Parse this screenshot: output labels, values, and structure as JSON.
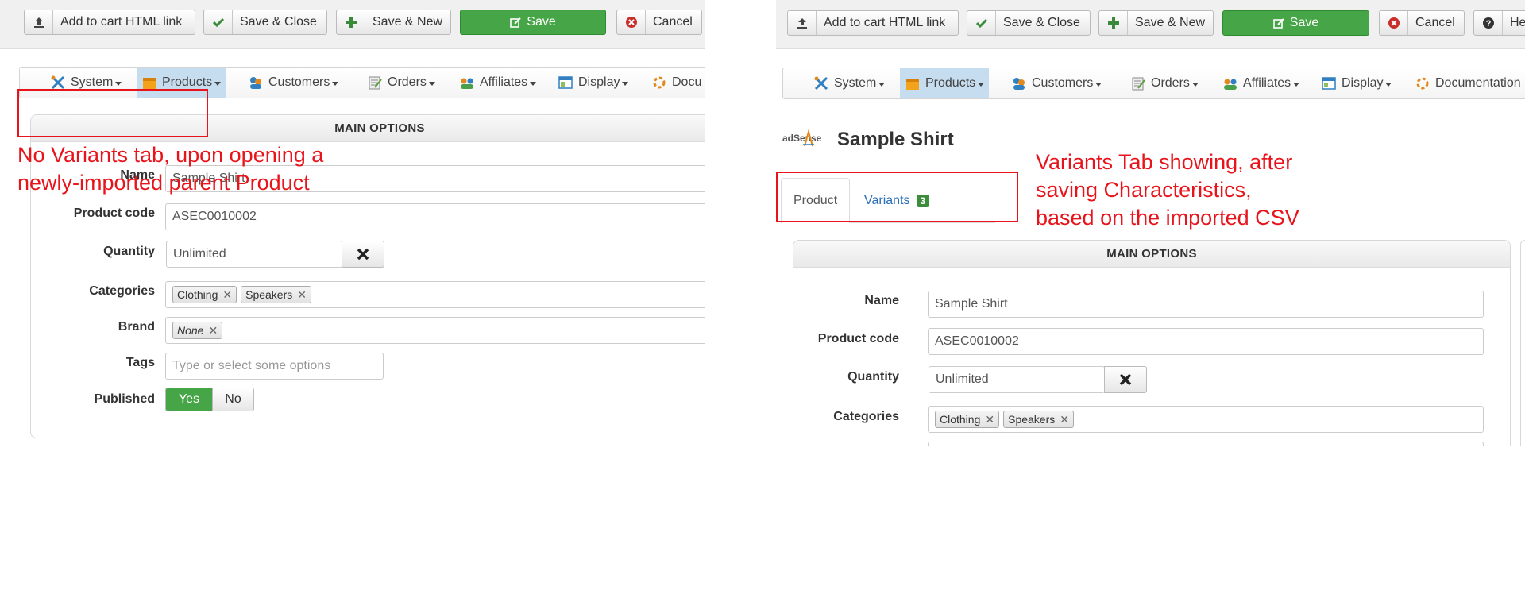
{
  "toolbar": {
    "add_to_cart_label": "Add to cart HTML link",
    "save_close_label": "Save & Close",
    "save_new_label": "Save & New",
    "save_label": "Save",
    "cancel_label": "Cancel",
    "help_label": "He"
  },
  "menu": {
    "system": "System",
    "products": "Products",
    "customers": "Customers",
    "orders": "Orders",
    "affiliates": "Affiliates",
    "display": "Display",
    "documentation_left": "Docu",
    "documentation_right": "Documentation"
  },
  "main_options_title": "MAIN OPTIONS",
  "form": {
    "name_label": "Name",
    "name_value": "Sample Shirt",
    "code_label": "Product code",
    "code_value": "ASEC0010002",
    "quantity_label": "Quantity",
    "quantity_value": "Unlimited",
    "categories_label": "Categories",
    "categories": [
      "Clothing",
      "Speakers"
    ],
    "brand_label": "Brand",
    "brand_value": "None",
    "tags_label": "Tags",
    "tags_placeholder": "Type or select some options",
    "published_label": "Published",
    "published_yes": "Yes",
    "published_no": "No"
  },
  "product": {
    "title": "Sample Shirt",
    "logo_text": "adSense"
  },
  "tabs": {
    "product": "Product",
    "variants": "Variants",
    "variants_count": "3"
  },
  "annotations": {
    "left": [
      "No Variants tab, upon opening a",
      "newly-imported parent Product"
    ],
    "right": [
      "Variants Tab showing, after",
      "saving Characteristics,",
      "based on the imported CSV"
    ]
  },
  "colors": {
    "save_green": "#46a546",
    "active_menu": "#c6ddf0",
    "annotation_red": "#e8141b",
    "link_blue": "#2a6ebb",
    "badge_green": "#3c8c3c"
  }
}
